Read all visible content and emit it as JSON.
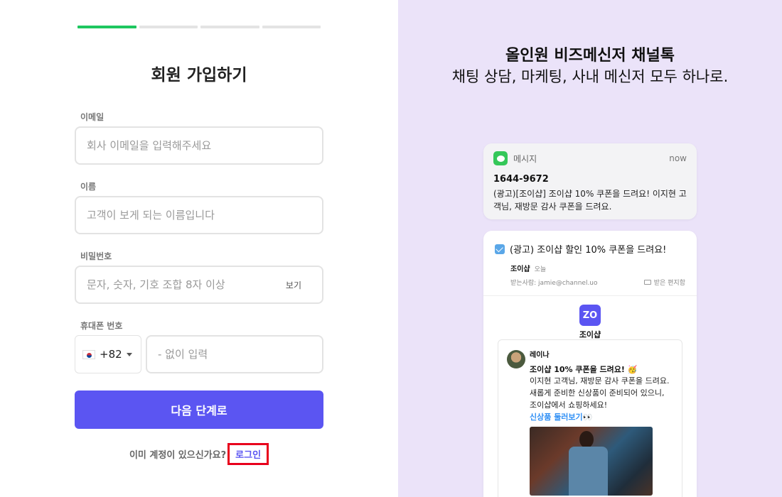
{
  "signup": {
    "progress": {
      "total_steps": 4,
      "current_step": 1
    },
    "title": "회원 가입하기",
    "email": {
      "label": "이메일",
      "placeholder": "회사 이메일을 입력해주세요",
      "value": ""
    },
    "name": {
      "label": "이름",
      "placeholder": "고객이 보게 되는 이름입니다",
      "value": ""
    },
    "password": {
      "label": "비밀번호",
      "placeholder": "문자, 숫자, 기호 조합 8자 이상",
      "value": "",
      "toggle_label": "보기"
    },
    "phone": {
      "label": "휴대폰 번호",
      "country_code": "+82",
      "country_flag": "KR",
      "placeholder": "- 없이 입력",
      "value": ""
    },
    "next_button": "다음 단계로",
    "login_prompt": "이미 계정이 있으신가요?",
    "login_link": "로그인"
  },
  "promo": {
    "title": "올인원 비즈메신저 채널톡",
    "subtitle": "채팅 상담, 마케팅, 사내 메신저 모두 하나로.",
    "colors": {
      "background": "#ebe3f9",
      "accent": "#5b55f2",
      "progress": "#1ec75f"
    },
    "sms": {
      "app": "메시지",
      "time": "now",
      "sender": "1644-9672",
      "body": "(광고)[조이샵] 조이샵 10% 쿠폰을 드려요! 이지현 고객님, 재방문 감사 쿠폰을 드려요."
    },
    "email": {
      "subject": "(광고) 조이샵 할인 10% 쿠폰을 드려요!",
      "from": "조이샵",
      "date": "오늘",
      "to": "받는사람: jamie@channel.uo",
      "folder": "받은 편지함",
      "brand_logo": "ZO",
      "brand_name": "조이샵",
      "message": {
        "author": "레이나",
        "headline": "조이샵 10% 쿠폰을 드려요! 🥳",
        "body": "이지현 고객님, 재방문 감사 쿠폰을 드려요. 새롭게 준비한 신상품이 준비되어 있으니, 조이샵에서 쇼핑하세요!",
        "link": "신상품 둘러보기👀"
      }
    }
  }
}
